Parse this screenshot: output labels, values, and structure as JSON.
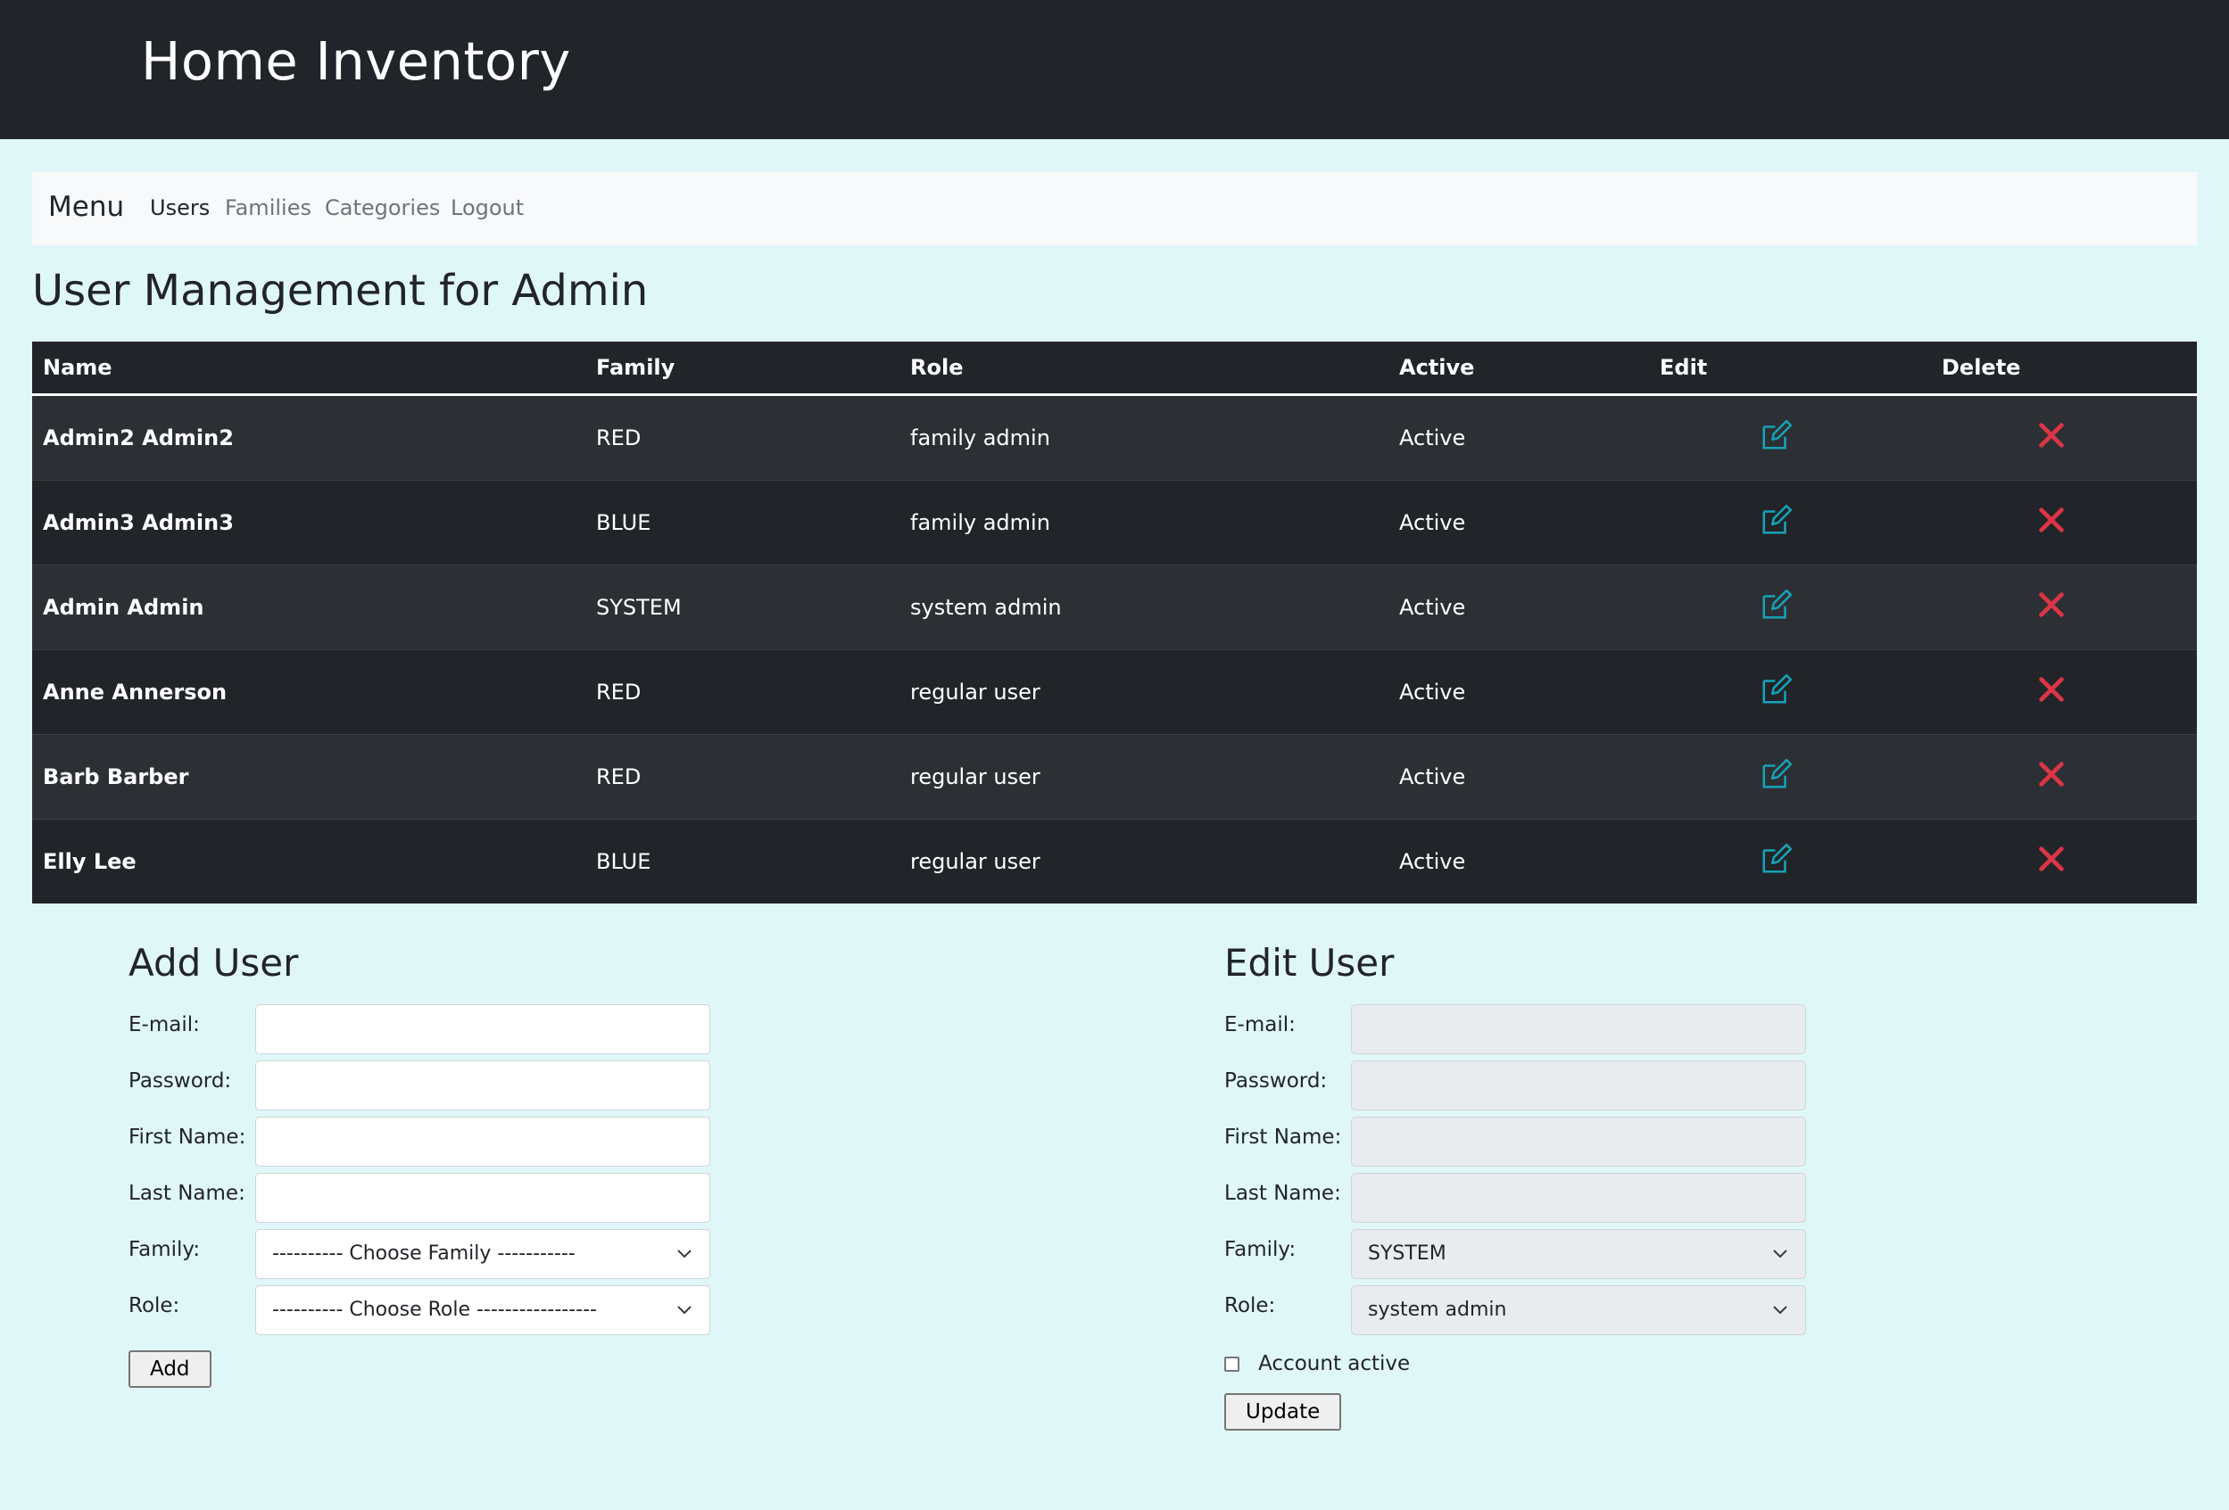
{
  "header": {
    "title": "Home Inventory"
  },
  "nav": {
    "brand": "Menu",
    "links": [
      "Users",
      "Families",
      "Categories",
      "Logout"
    ],
    "active": "Users"
  },
  "page_title": "User Management for Admin",
  "table": {
    "columns": [
      "Name",
      "Family",
      "Role",
      "Active",
      "Edit",
      "Delete"
    ],
    "rows": [
      {
        "name": "Admin2 Admin2",
        "family": "RED",
        "role": "family admin",
        "active": "Active"
      },
      {
        "name": "Admin3 Admin3",
        "family": "BLUE",
        "role": "family admin",
        "active": "Active"
      },
      {
        "name": "Admin Admin",
        "family": "SYSTEM",
        "role": "system admin",
        "active": "Active"
      },
      {
        "name": "Anne Annerson",
        "family": "RED",
        "role": "regular user",
        "active": "Active"
      },
      {
        "name": "Barb Barber",
        "family": "RED",
        "role": "regular user",
        "active": "Active"
      },
      {
        "name": "Elly Lee",
        "family": "BLUE",
        "role": "regular user",
        "active": "Active"
      }
    ],
    "edit_icon": "edit-pencil-square-icon",
    "delete_icon": "close-x-icon"
  },
  "add_user": {
    "title": "Add User",
    "email_label": "E-mail:",
    "password_label": "Password:",
    "first_name_label": "First Name:",
    "last_name_label": "Last Name:",
    "family_label": "Family:",
    "role_label": "Role:",
    "email_value": "",
    "password_value": "",
    "first_name_value": "",
    "last_name_value": "",
    "family_selected": "---------- Choose Family -----------",
    "role_selected": "---------- Choose Role -----------------",
    "submit_label": "Add"
  },
  "edit_user": {
    "title": "Edit User",
    "email_label": "E-mail:",
    "password_label": "Password:",
    "first_name_label": "First Name:",
    "last_name_label": "Last Name:",
    "family_label": "Family:",
    "role_label": "Role:",
    "family_selected": "SYSTEM",
    "role_selected": "system admin",
    "active_label": "Account active",
    "active_checked": false,
    "submit_label": "Update"
  },
  "colors": {
    "header_bg": "#212529",
    "page_bg": "#e0f7f7",
    "edit_icon": "#17a2b8",
    "delete_icon": "#dc3545"
  }
}
